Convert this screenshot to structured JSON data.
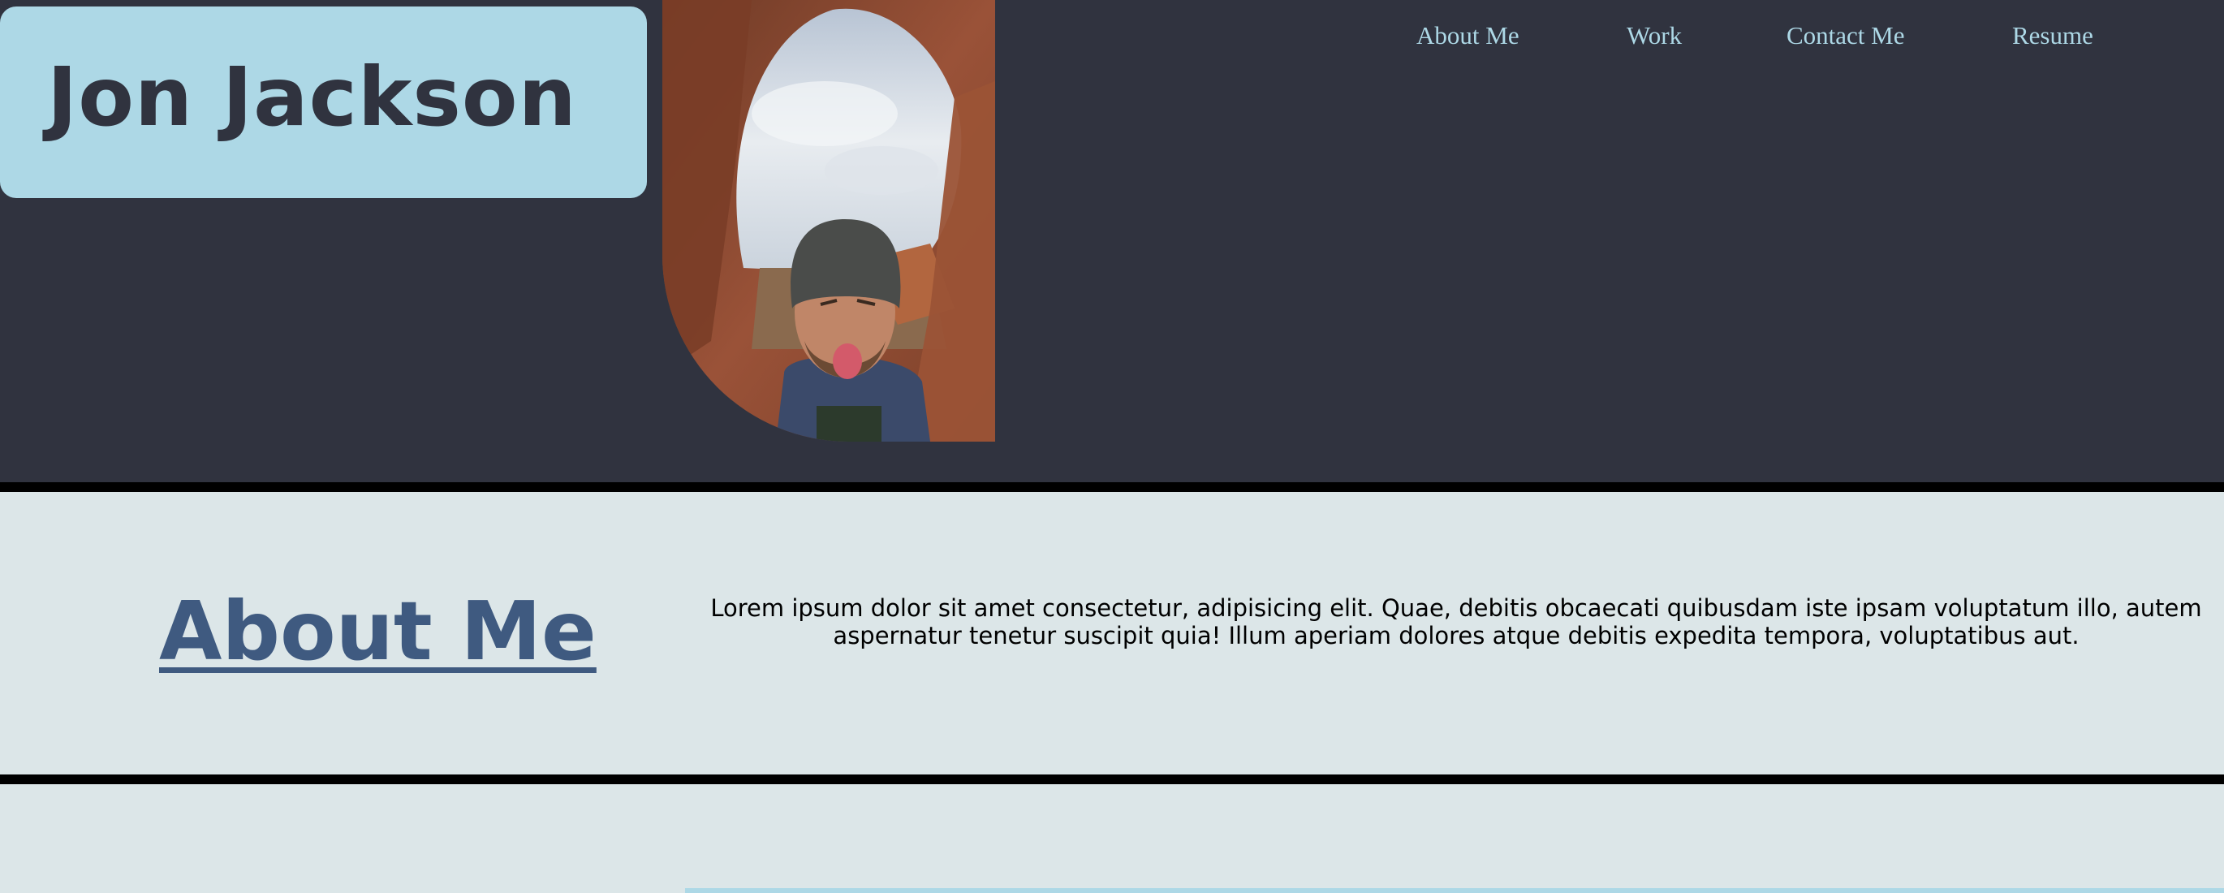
{
  "header": {
    "name": "Jon Jackson",
    "portrait_icon": "portrait-photo"
  },
  "nav": {
    "items": [
      {
        "label": "About Me"
      },
      {
        "label": "Work"
      },
      {
        "label": "Contact Me"
      },
      {
        "label": "Resume"
      }
    ]
  },
  "about": {
    "heading": "About Me",
    "text": "Lorem ipsum dolor sit amet consectetur, adipisicing elit. Quae, debitis obcaecati quibusdam iste ipsam voluptatum illo, autem aspernatur tenetur suscipit quia! Illum aperiam dolores atque debitis expedita tempora, voluptatibus aut."
  },
  "colors": {
    "header_bg": "#30333f",
    "accent": "#add8e6",
    "section_bg": "#dce6e8",
    "heading": "#3f5a80",
    "divider": "#000000"
  }
}
